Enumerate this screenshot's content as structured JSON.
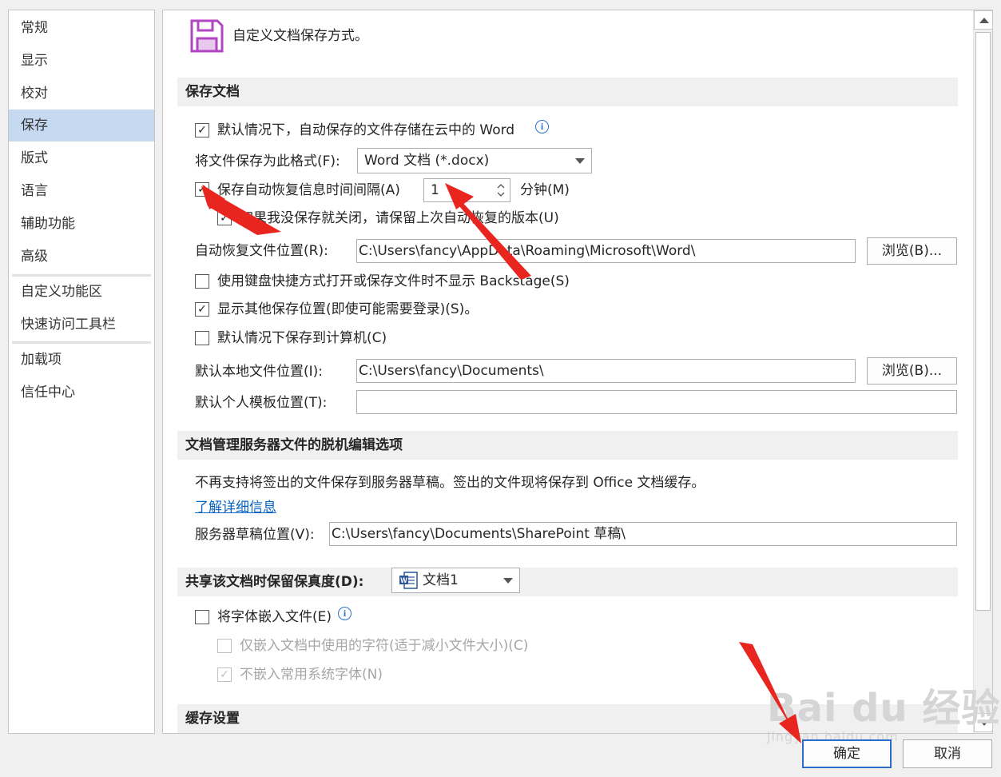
{
  "nav": {
    "items": [
      "常规",
      "显示",
      "校对",
      "保存",
      "版式",
      "语言",
      "辅助功能",
      "高级",
      "自定义功能区",
      "快速访问工具栏",
      "加载项",
      "信任中心"
    ],
    "selected": "保存"
  },
  "header": {
    "title": "自定义文档保存方式。",
    "icon": "save-floppy-icon"
  },
  "save_doc": {
    "heading": "保存文档",
    "autosave_cloud": {
      "label": "默认情况下，自动保存的文件存储在云中的 Word",
      "checked": true
    },
    "format_label": "将文件保存为此格式(F):",
    "format_value": "Word 文档 (*.docx)",
    "autorecover": {
      "label": "保存自动恢复信息时间间隔(A)",
      "checked": true
    },
    "interval_value": "1",
    "interval_unit": "分钟(M)",
    "keep_last": {
      "label": "如果我没保存就关闭，请保留上次自动恢复的版本(U)",
      "checked": true
    },
    "autorecover_location_label": "自动恢复文件位置(R):",
    "autorecover_location_value": "C:\\Users\\fancy\\AppData\\Roaming\\Microsoft\\Word\\",
    "browse1": "浏览(B)...",
    "no_backstage": {
      "label": "使用键盘快捷方式打开或保存文件时不显示 Backstage(S)",
      "checked": false
    },
    "show_other": {
      "label": "显示其他保存位置(即使可能需要登录)(S)。",
      "checked": true
    },
    "save_to_computer": {
      "label": "默认情况下保存到计算机(C)",
      "checked": false
    },
    "local_location_label": "默认本地文件位置(I):",
    "local_location_value": "C:\\Users\\fancy\\Documents\\",
    "browse2": "浏览(B)...",
    "template_location_label": "默认个人模板位置(T):",
    "template_location_value": ""
  },
  "offline": {
    "heading": "文档管理服务器文件的脱机编辑选项",
    "note": "不再支持将签出的文件保存到服务器草稿。签出的文件现将保存到 Office 文档缓存。",
    "learn_more": "了解详细信息",
    "drafts_label": "服务器草稿位置(V):",
    "drafts_value": "C:\\Users\\fancy\\Documents\\SharePoint 草稿\\"
  },
  "fidelity": {
    "heading": "共享该文档时保留保真度(D):",
    "doc_value": "文档1",
    "embed_fonts": {
      "label": "将字体嵌入文件(E)",
      "checked": false
    },
    "embed_used": {
      "label": "仅嵌入文档中使用的字符(适于减小文件大小)(C)",
      "checked": false
    },
    "no_common": {
      "label": "不嵌入常用系统字体(N)",
      "checked": true
    }
  },
  "cache": {
    "heading": "缓存设置"
  },
  "buttons": {
    "ok": "确定",
    "cancel": "取消"
  },
  "watermark": {
    "brand": "Bai du 经验",
    "url": "jingyan.baidu.com"
  },
  "colors": {
    "selected_nav": "#c5d9f1",
    "accent": "#2b6dc7",
    "arrow": "#e8251f",
    "icon": "#b146c2"
  }
}
